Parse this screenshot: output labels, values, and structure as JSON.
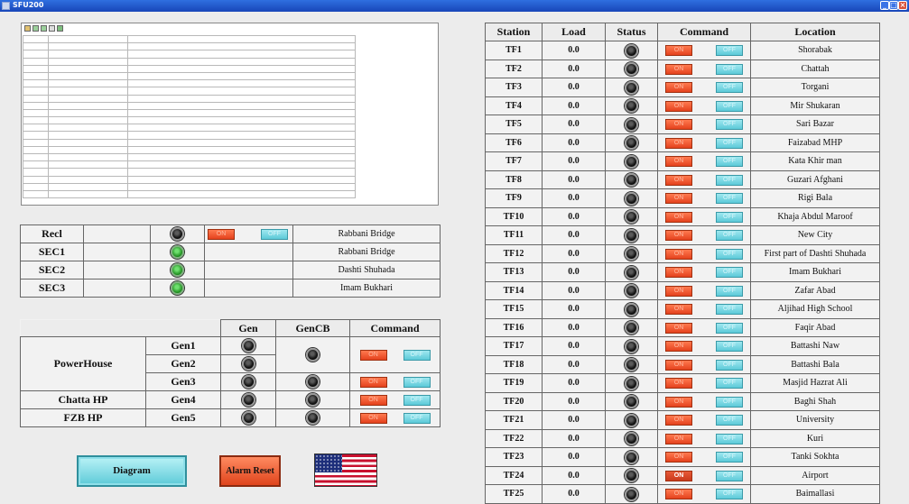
{
  "window": {
    "title": "SFU200"
  },
  "switches": [
    {
      "name": "Recl",
      "state": "off",
      "location": "Rabbani Bridge",
      "has_command": true,
      "on_label": "ON",
      "off_label": "OFF"
    },
    {
      "name": "SEC1",
      "state": "on",
      "location": "Rabbani Bridge",
      "has_command": false
    },
    {
      "name": "SEC2",
      "state": "on",
      "location": "Dashti Shuhada",
      "has_command": false
    },
    {
      "name": "SEC3",
      "state": "on",
      "location": "Imam Bukhari",
      "has_command": false
    }
  ],
  "generators": {
    "headers": {
      "gen": "Gen",
      "gencb": "GenCB",
      "command": "Command"
    },
    "sites": [
      {
        "name": "PowerHouse"
      },
      {
        "name": "Chatta HP"
      },
      {
        "name": "FZB HP"
      }
    ],
    "units": [
      "Gen1",
      "Gen2",
      "Gen3",
      "Gen4",
      "Gen5"
    ],
    "on_label": "ON",
    "off_label": "OFF"
  },
  "buttons": {
    "diagram": "Diagram",
    "alarm_reset": "Alarm Reset"
  },
  "flag_icon": "us-flag-icon",
  "stations": {
    "headers": {
      "station": "Station",
      "load": "Load",
      "status": "Status",
      "command": "Command",
      "location": "Location"
    },
    "on_label": "ON",
    "off_label": "OFF",
    "rows": [
      {
        "id": "TF1",
        "load": "0.0",
        "location": "Shorabak",
        "on_active": false
      },
      {
        "id": "TF2",
        "load": "0.0",
        "location": "Chattah",
        "on_active": false
      },
      {
        "id": "TF3",
        "load": "0.0",
        "location": "Torgani",
        "on_active": false
      },
      {
        "id": "TF4",
        "load": "0.0",
        "location": "Mir Shukaran",
        "on_active": false
      },
      {
        "id": "TF5",
        "load": "0.0",
        "location": "Sari Bazar",
        "on_active": false
      },
      {
        "id": "TF6",
        "load": "0.0",
        "location": "Faizabad MHP",
        "on_active": false
      },
      {
        "id": "TF7",
        "load": "0.0",
        "location": "Kata Khir man",
        "on_active": false
      },
      {
        "id": "TF8",
        "load": "0.0",
        "location": "Guzari Afghani",
        "on_active": false
      },
      {
        "id": "TF9",
        "load": "0.0",
        "location": "Rigi Bala",
        "on_active": false
      },
      {
        "id": "TF10",
        "load": "0.0",
        "location": "Khaja Abdul Maroof",
        "on_active": false
      },
      {
        "id": "TF11",
        "load": "0.0",
        "location": "New City",
        "on_active": false
      },
      {
        "id": "TF12",
        "load": "0.0",
        "location": "First part of Dashti Shuhada",
        "on_active": false
      },
      {
        "id": "TF13",
        "load": "0.0",
        "location": "Imam Bukhari",
        "on_active": false
      },
      {
        "id": "TF14",
        "load": "0.0",
        "location": "Zafar Abad",
        "on_active": false
      },
      {
        "id": "TF15",
        "load": "0.0",
        "location": "Aljihad High School",
        "on_active": false
      },
      {
        "id": "TF16",
        "load": "0.0",
        "location": "Faqir Abad",
        "on_active": false
      },
      {
        "id": "TF17",
        "load": "0.0",
        "location": "Battashi Naw",
        "on_active": false
      },
      {
        "id": "TF18",
        "load": "0.0",
        "location": "Battashi Bala",
        "on_active": false
      },
      {
        "id": "TF19",
        "load": "0.0",
        "location": "Masjid Hazrat Ali",
        "on_active": false
      },
      {
        "id": "TF20",
        "load": "0.0",
        "location": "Baghi Shah",
        "on_active": false
      },
      {
        "id": "TF21",
        "load": "0.0",
        "location": "University",
        "on_active": false
      },
      {
        "id": "TF22",
        "load": "0.0",
        "location": "Kuri",
        "on_active": false
      },
      {
        "id": "TF23",
        "load": "0.0",
        "location": "Tanki Sokhta",
        "on_active": false
      },
      {
        "id": "TF24",
        "load": "0.0",
        "location": "Airport",
        "on_active": true
      },
      {
        "id": "TF25",
        "load": "0.0",
        "location": "Baimallasi",
        "on_active": false
      }
    ]
  }
}
